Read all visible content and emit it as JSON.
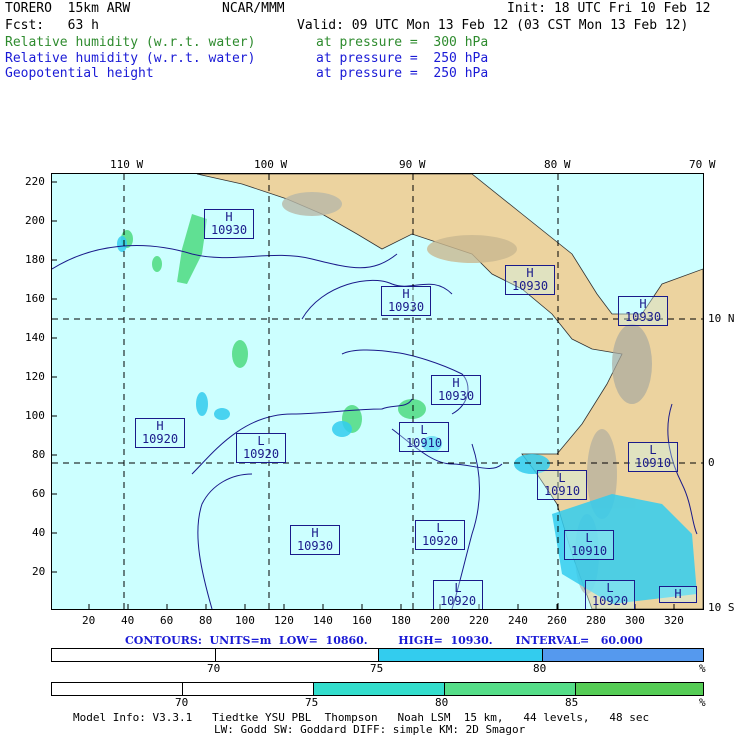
{
  "header": {
    "model": "TORERO  15km ARW",
    "org": "NCAR/MMM",
    "init": "Init: 18 UTC Fri 10 Feb 12",
    "fcst": "Fcst:   63 h",
    "valid": "Valid: 09 UTC Mon 13 Feb 12 (03 CST Mon 13 Feb 12)",
    "fields": [
      {
        "name": "Relative humidity (w.r.t. water)",
        "level": "at pressure =  300 hPa",
        "color": "#2e8b2e"
      },
      {
        "name": "Relative humidity (w.r.t. water)",
        "level": "at pressure =  250 hPa",
        "color": "#1a1ad6"
      },
      {
        "name": "Geopotential height",
        "level": "at pressure =  250 hPa",
        "color": "#1a1ad6"
      }
    ]
  },
  "map": {
    "top_ticks": [
      "110 W",
      "100 W",
      "90 W",
      "80 W",
      "70 W"
    ],
    "right_ticks": [
      "10 N",
      "0",
      "10 S"
    ],
    "left_ticks": [
      "220",
      "200",
      "180",
      "160",
      "140",
      "120",
      "100",
      "80",
      "60",
      "40",
      "20"
    ],
    "bottom_ticks": [
      "20",
      "40",
      "60",
      "80",
      "100",
      "120",
      "140",
      "160",
      "180",
      "200",
      "220",
      "240",
      "260",
      "280",
      "300",
      "320"
    ],
    "pressure_centers": [
      {
        "type": "H",
        "value": "10930"
      },
      {
        "type": "H",
        "value": "10930"
      },
      {
        "type": "H",
        "value": "10930"
      },
      {
        "type": "H",
        "value": "10930"
      },
      {
        "type": "H",
        "value": "10930"
      },
      {
        "type": "H",
        "value": "10920"
      },
      {
        "type": "L",
        "value": "10920"
      },
      {
        "type": "L",
        "value": "10910"
      },
      {
        "type": "L",
        "value": "10910"
      },
      {
        "type": "L",
        "value": "10910"
      },
      {
        "type": "H",
        "value": "10930"
      },
      {
        "type": "L",
        "value": "10920"
      },
      {
        "type": "L",
        "value": "10910"
      },
      {
        "type": "L",
        "value": "10920"
      },
      {
        "type": "L",
        "value": "10920"
      },
      {
        "type": "H",
        "value": ""
      }
    ]
  },
  "contours": "CONTOURS:  UNITS=m  LOW=  10860.        HIGH=  10930.      INTERVAL=   60.000",
  "colorbar_250": {
    "labels": [
      "70",
      "75",
      "80",
      "%"
    ],
    "colors": [
      "#ffffff",
      "#ffffff",
      "#33ccee",
      "#5599ee"
    ]
  },
  "colorbar_300": {
    "labels": [
      "70",
      "75",
      "80",
      "85",
      "%"
    ],
    "colors": [
      "#ffffff",
      "#ffffff",
      "#33ddcc",
      "#55dd88",
      "#55cc55"
    ]
  },
  "footer": {
    "line1": "Model Info: V3.3.1   Tiedtke YSU PBL  Thompson   Noah LSM  15 km,   44 levels,   48 sec",
    "line2": "LW: Godd SW: Goddard DIFF: simple KM: 2D Smagor"
  }
}
